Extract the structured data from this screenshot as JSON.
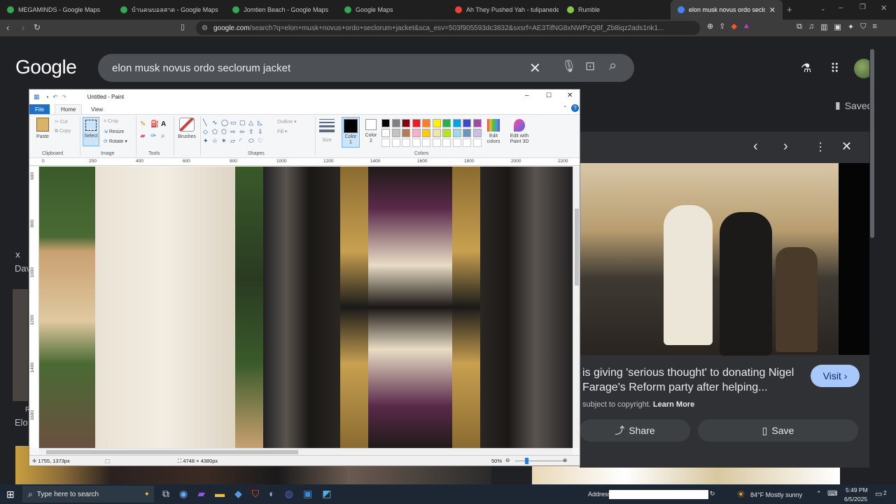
{
  "browser": {
    "tabs": [
      {
        "title": "MEGAMINDS - Google Maps",
        "color": "#34a853",
        "active": false
      },
      {
        "title": "บ้านคนบอลสาด - Google Maps",
        "color": "#34a853",
        "active": false
      },
      {
        "title": "Jomtien Beach - Google Maps",
        "color": "#34a853",
        "active": false
      },
      {
        "title": "Google Maps",
        "color": "#34a853",
        "active": false
      },
      {
        "title": "Ah They Pushed Yah - tulipanedeam",
        "color": "#ea4335",
        "active": false
      },
      {
        "title": "Rumble",
        "color": "#85c742",
        "active": false
      },
      {
        "title": "elon musk novus ordo seclorum",
        "color": "#4285f4",
        "active": true
      }
    ],
    "url_main": "google.com",
    "url_rest": "/search?q=elon+musk+novus+ordo+seclorum+jacket&sca_esv=503f905593dc3832&sxsrf=AE3TifNG8xNWPzQBf_Zb8iqz2ads1nk1..."
  },
  "google": {
    "logo": "Google",
    "query": "elon musk novus ordo seclorum jacket",
    "saved_label": "Saved",
    "left_fragments": {
      "x": "X",
      "dav": "Dav",
      "elo": "Elo",
      "r": "R"
    }
  },
  "panel": {
    "title": "is giving 'serious thought' to donating Nigel Farage's Reform party after helping...",
    "visit_label": "Visit",
    "copyright_text": "subject to copyright.",
    "learn_more": "Learn More",
    "share_label": "Share",
    "save_label": "Save"
  },
  "paint": {
    "title": "Untitled - Paint",
    "tabs": {
      "file": "File",
      "home": "Home",
      "view": "View"
    },
    "clipboard": {
      "paste": "Paste",
      "cut": "Cut",
      "copy": "Copy",
      "group": "Clipboard"
    },
    "image": {
      "select": "Select",
      "crop": "Crop",
      "resize": "Resize",
      "rotate": "Rotate",
      "group": "Image"
    },
    "tools_group": "Tools",
    "brushes": "Brushes",
    "shapes": {
      "outline": "Outline",
      "fill": "Fill",
      "group": "Shapes"
    },
    "size": "Size",
    "color1": "Color 1",
    "color2": "Color 2",
    "colors_group": "Colors",
    "edit_colors": "Edit colors",
    "edit_paint3d": "Edit with Paint 3D",
    "palette": [
      "#000000",
      "#7f7f7f",
      "#880015",
      "#ed1c24",
      "#ff7f27",
      "#fff200",
      "#22b14c",
      "#00a2e8",
      "#3f48cc",
      "#a349a4",
      "#ffffff",
      "#c3c3c3",
      "#b97a57",
      "#ffaec9",
      "#ffc90e",
      "#efe4b0",
      "#b5e61d",
      "#99d9ea",
      "#7092be",
      "#c8bfe7"
    ],
    "ruler_ticks": [
      "0",
      "200",
      "400",
      "600",
      "800",
      "1000",
      "1200",
      "1400",
      "1600",
      "1800",
      "2000",
      "2200"
    ],
    "vruler_ticks": [
      "600",
      "800",
      "1000",
      "1200",
      "1400",
      "1600"
    ],
    "status": {
      "cursor": "1755, 1373px",
      "size": "4748 × 4380px",
      "zoom": "50%"
    }
  },
  "taskbar": {
    "search_placeholder": "Type here to search",
    "address_label": "Address",
    "weather": "84°F  Mostly sunny",
    "time": "5:49 PM",
    "date": "6/5/2025",
    "notif_count": "2"
  }
}
